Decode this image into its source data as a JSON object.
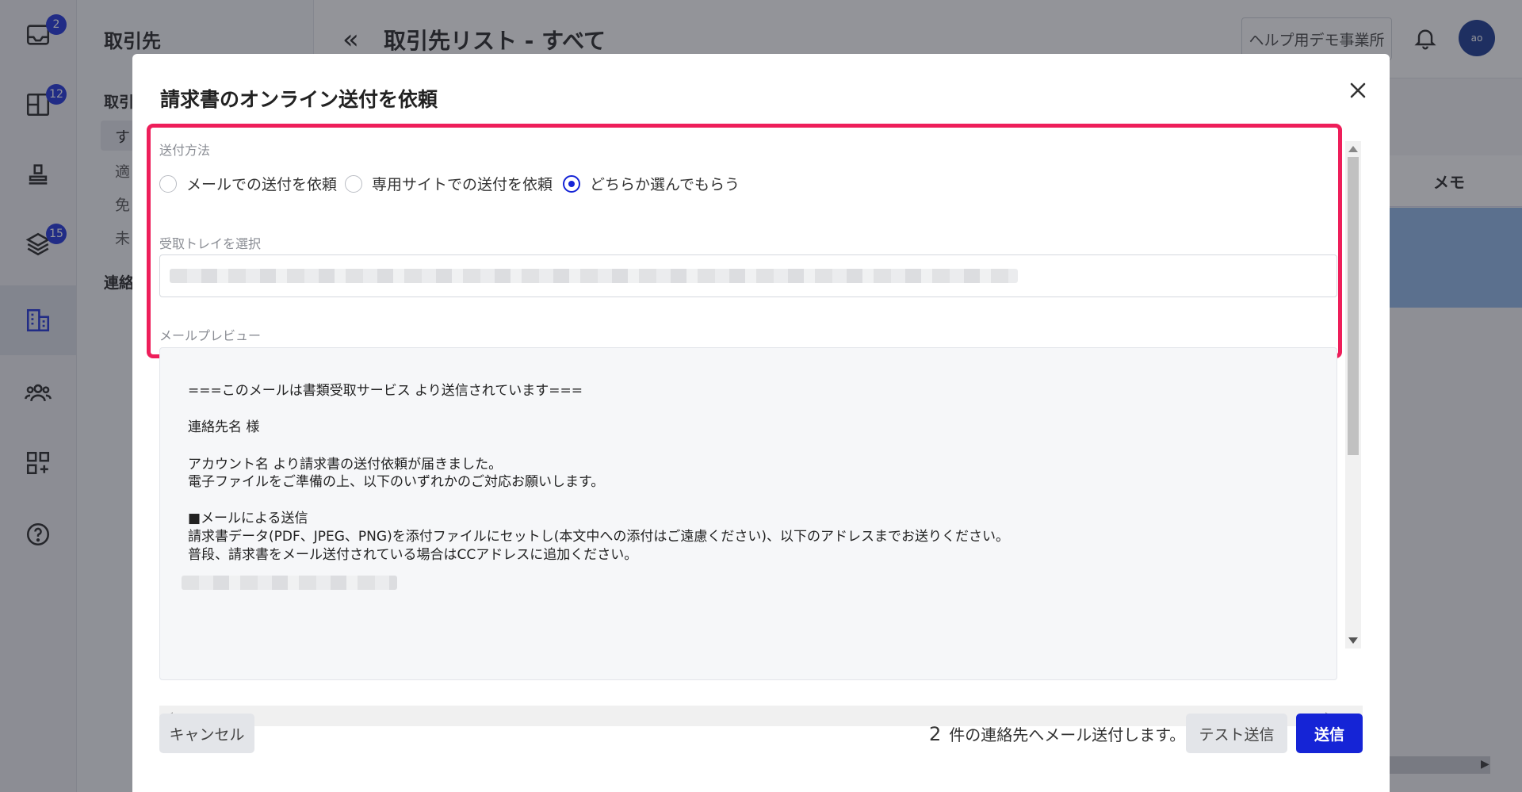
{
  "rail": {
    "items": [
      {
        "icon": "inbox-icon",
        "badge": "2"
      },
      {
        "icon": "grid-icon",
        "badge": "12"
      },
      {
        "icon": "stamp-icon",
        "badge": ""
      },
      {
        "icon": "layers-icon",
        "badge": "15"
      },
      {
        "icon": "building-icon",
        "badge": ""
      },
      {
        "icon": "users-icon",
        "badge": ""
      },
      {
        "icon": "apps-add-icon",
        "badge": ""
      },
      {
        "icon": "help-icon",
        "badge": ""
      }
    ]
  },
  "subnav": {
    "title": "取引先",
    "group_label": "取引",
    "items": [
      "す",
      "適",
      "免",
      "未"
    ],
    "group2_label": "連絡"
  },
  "header": {
    "title": "取引先リスト - すべて",
    "business_button": "ヘルプ用デモ事業所",
    "avatar_initials": "ao"
  },
  "table": {
    "column_memo": "メモ"
  },
  "modal": {
    "title": "請求書のオンライン送付を依頼",
    "method_label": "送付方法",
    "methods": [
      {
        "label": "メールでの送付を依頼",
        "checked": false
      },
      {
        "label": "専用サイトでの送付を依頼",
        "checked": false
      },
      {
        "label": "どちらか選んでもらう",
        "checked": true
      }
    ],
    "tray_label": "受取トレイを選択",
    "preview_label": "メールプレビュー",
    "preview_lines": [
      "===このメールは書類受取サービス より送信されています===",
      "連絡先名 様",
      "アカウント名 より請求書の送付依頼が届きました。",
      "電子ファイルをご準備の上、以下のいずれかのご対応お願いします。",
      "■メールによる送信",
      "請求書データ(PDF、JPEG、PNG)を添付ファイルにセットし(本文中への添付はご遠慮ください)、以下のアドレスまでお送りください。",
      "普段、請求書をメール送付されている場合はCCアドレスに追加ください。"
    ],
    "cancel_label": "キャンセル",
    "recipient_count": "2",
    "recipient_text": "件の連絡先へメール送付します。",
    "test_send_label": "テスト送信",
    "send_label": "送信"
  },
  "colors": {
    "primary": "#1524d6",
    "highlight": "#ee1e5a",
    "badge": "#1b2fd9"
  }
}
